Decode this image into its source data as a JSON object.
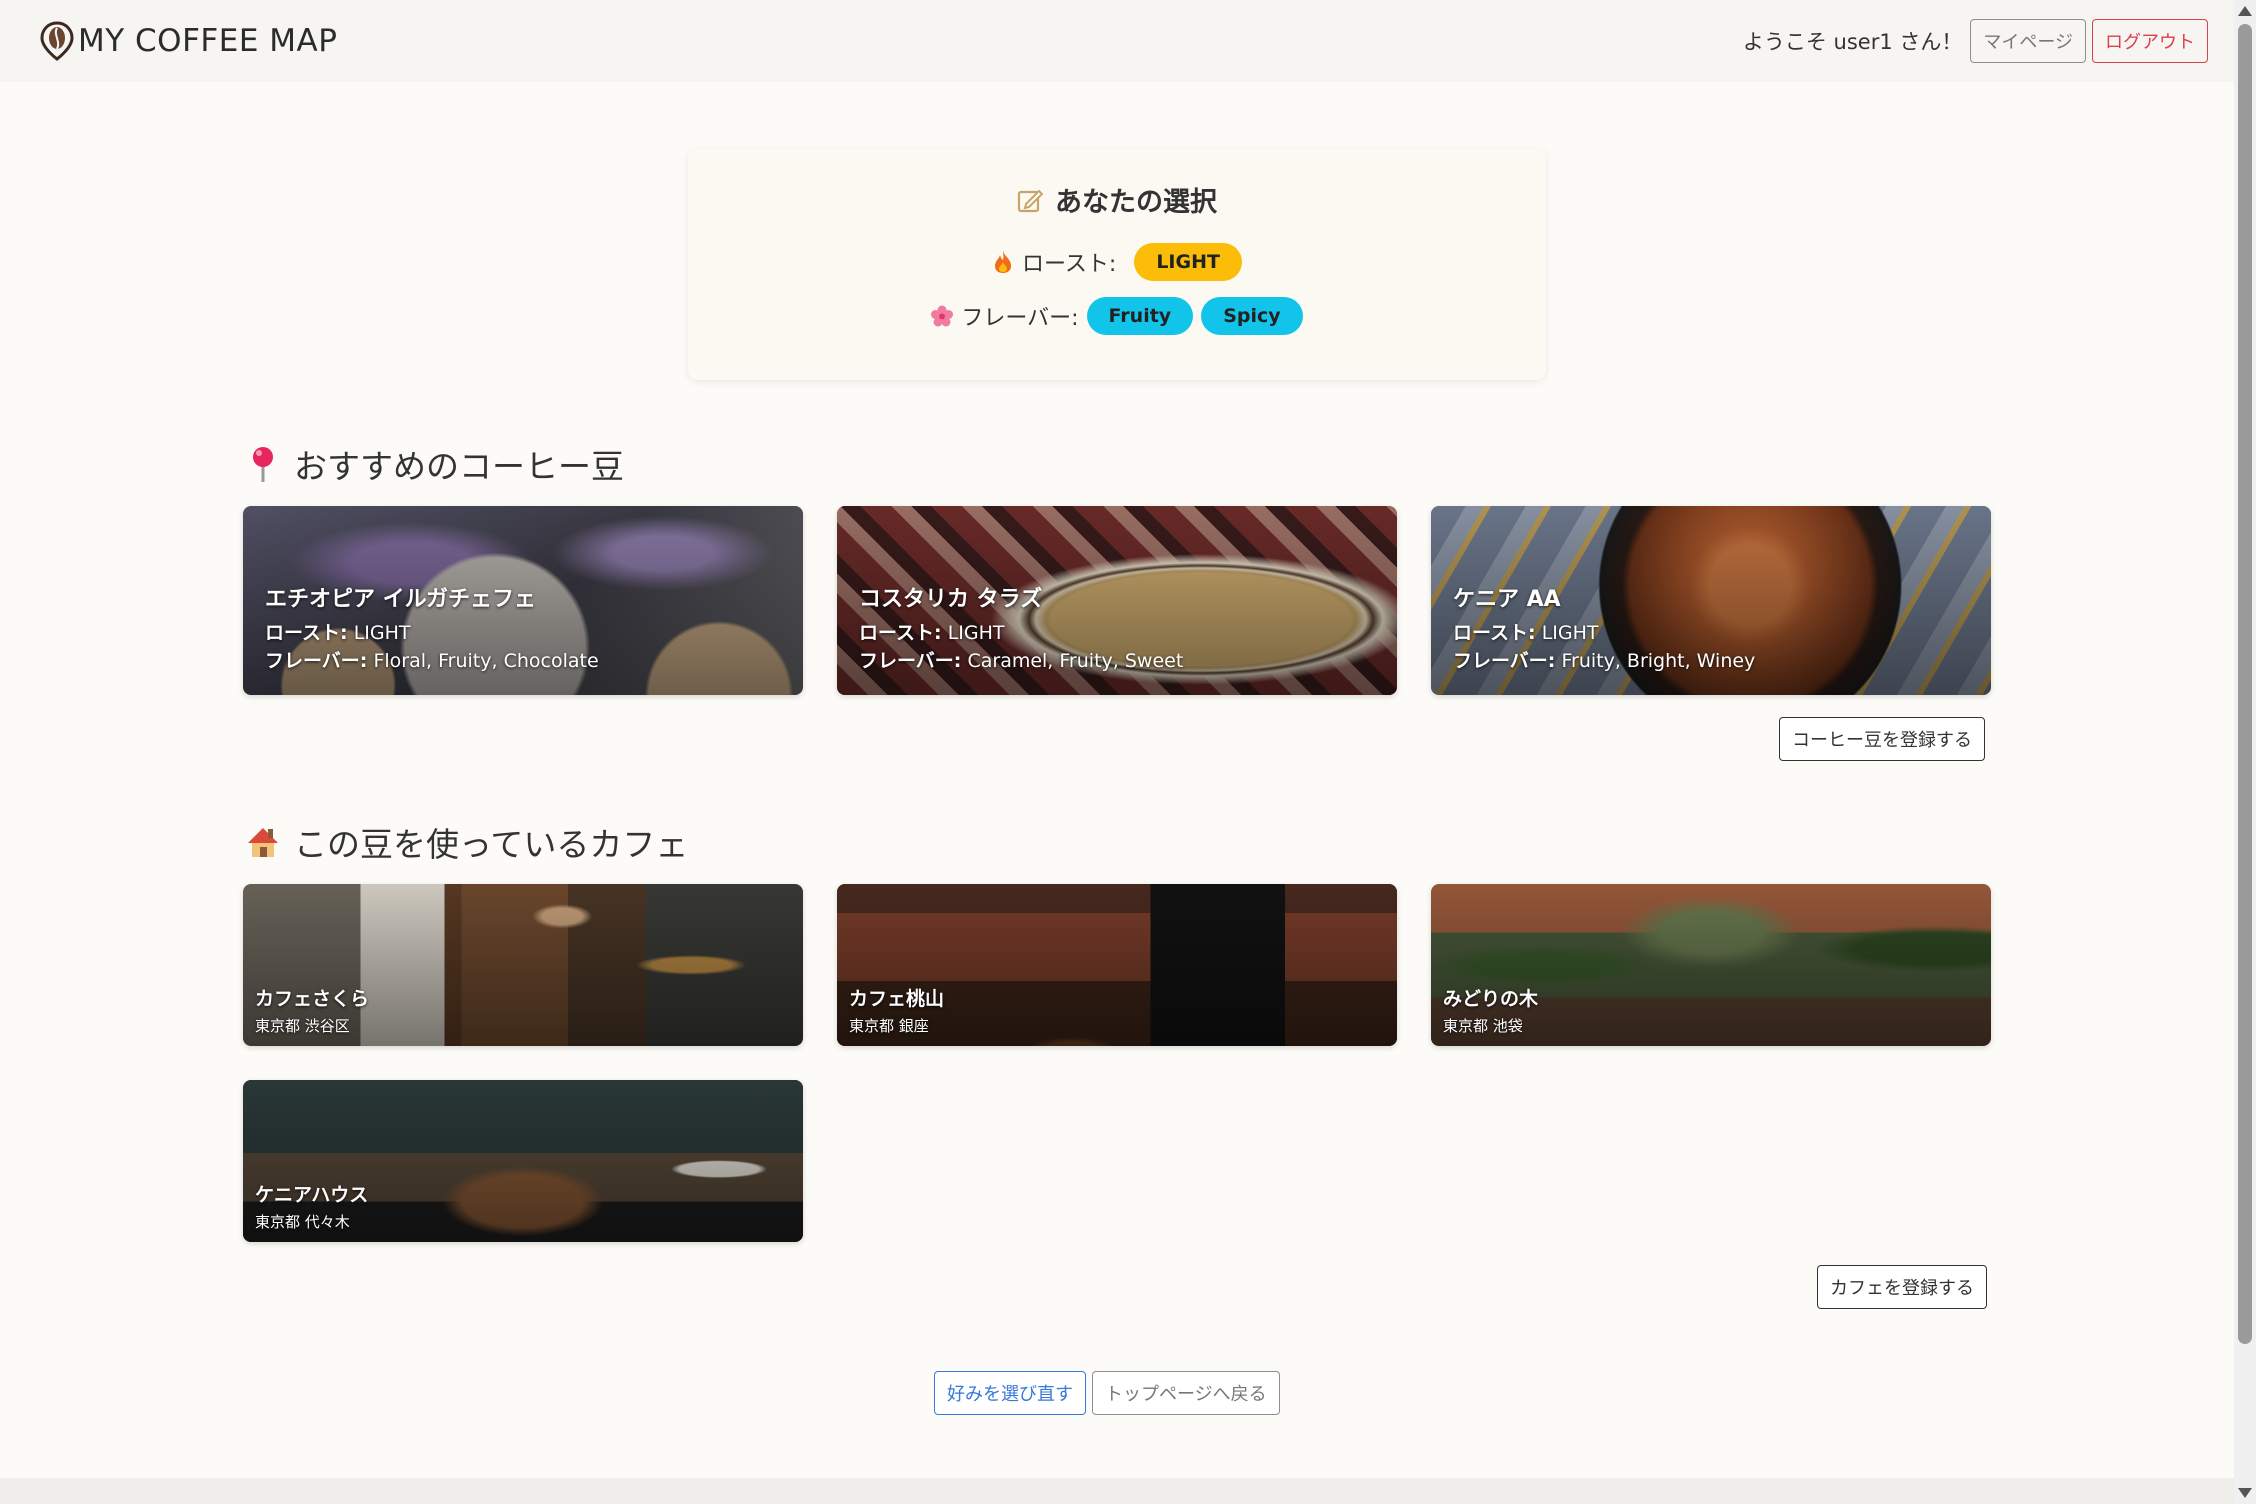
{
  "header": {
    "brand": "MY COFFEE MAP",
    "welcome": "ようこそ user1 さん！",
    "mypage_label": "マイページ",
    "logout_label": "ログアウト"
  },
  "selection": {
    "title": "あなたの選択",
    "roast_label": "ロースト:",
    "roast_value": "LIGHT",
    "flavor_label": "フレーバー:",
    "flavors": [
      "Fruity",
      "Spicy"
    ]
  },
  "beans_section": {
    "title": "おすすめのコーヒー豆",
    "roast_key": "ロースト:",
    "flavor_key": "フレーバー:",
    "items": [
      {
        "name": "エチオピア イルガチェフェ",
        "roast": "LIGHT",
        "flavors": "Floral, Fruity, Chocolate"
      },
      {
        "name": "コスタリカ タラズ",
        "roast": "LIGHT",
        "flavors": "Caramel, Fruity, Sweet"
      },
      {
        "name": "ケニア AA",
        "roast": "LIGHT",
        "flavors": "Fruity, Bright, Winey"
      }
    ],
    "register_label": "コーヒー豆を登録する"
  },
  "cafes_section": {
    "title": "この豆を使っているカフェ",
    "items": [
      {
        "name": "カフェさくら",
        "location": "東京都 渋谷区"
      },
      {
        "name": "カフェ桃山",
        "location": "東京都 銀座"
      },
      {
        "name": "みどりの木",
        "location": "東京都 池袋"
      },
      {
        "name": "ケニアハウス",
        "location": "東京都 代々木"
      }
    ],
    "register_label": "カフェを登録する"
  },
  "footer_actions": {
    "reselect_label": "好みを選び直す",
    "back_label": "トップページへ戻る"
  },
  "colors": {
    "page_bg": "#fdfbf7",
    "roast_pill": "#fbbd08",
    "flavor_pill": "#12c4ea",
    "logout": "#d9414e",
    "reselect": "#3778d8"
  }
}
